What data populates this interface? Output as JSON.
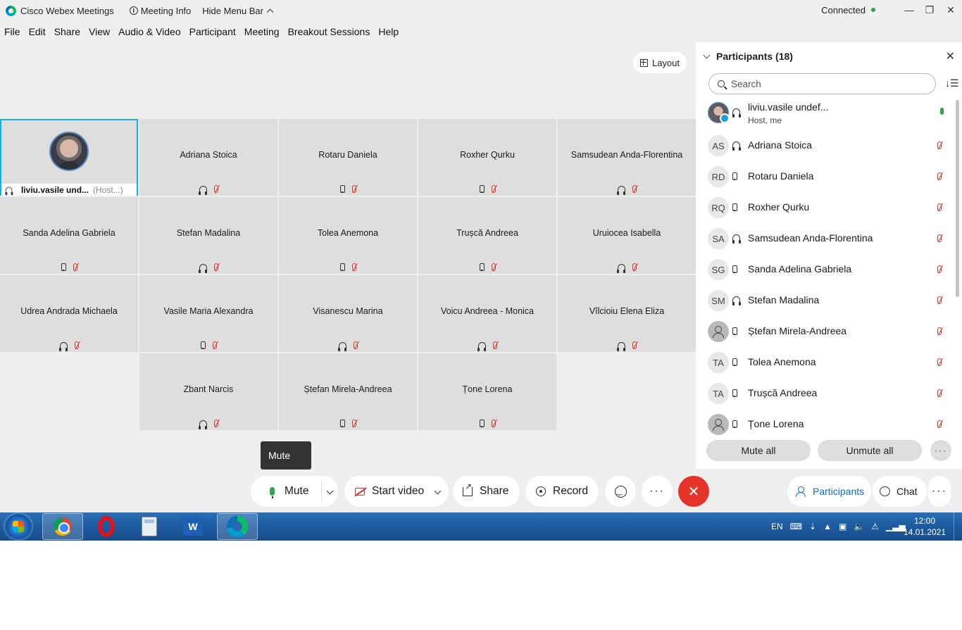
{
  "titlebar": {
    "app_name": "Cisco Webex Meetings",
    "meeting_info": "Meeting Info",
    "hide_menu_bar": "Hide Menu Bar",
    "status": "Connected"
  },
  "menu": [
    "File",
    "Edit",
    "Share",
    "View",
    "Audio & Video",
    "Participant",
    "Meeting",
    "Breakout Sessions",
    "Help"
  ],
  "layout_button": "Layout",
  "host_tile": {
    "name": "liviu.vasile und...",
    "role": "(Host...)"
  },
  "tiles": [
    {
      "name": "Adriana Stoica",
      "device": "headset"
    },
    {
      "name": "Rotaru Daniela",
      "device": "phone"
    },
    {
      "name": "Roxher Qurku",
      "device": "phone"
    },
    {
      "name": "Samsudean Anda-Florentina",
      "device": "headset"
    },
    {
      "name": "Sanda Adelina Gabriela",
      "device": "phone"
    },
    {
      "name": "Stefan Madalina",
      "device": "headset"
    },
    {
      "name": "Tolea Anemona",
      "device": "phone"
    },
    {
      "name": "Trușcă Andreea",
      "device": "phone"
    },
    {
      "name": "Uruiocea Isabella",
      "device": "headset"
    },
    {
      "name": "Udrea Andrada Michaela",
      "device": "headset"
    },
    {
      "name": "Vasile Maria Alexandra",
      "device": "phone"
    },
    {
      "name": "Visanescu Marina",
      "device": "headset"
    },
    {
      "name": "Voicu Andreea - Monica",
      "device": "headset"
    },
    {
      "name": "Vîlcioiu Elena Eliza",
      "device": "headset"
    },
    {
      "name": "Zbant Narcis",
      "device": "headset"
    },
    {
      "name": "Ștefan Mirela-Andreea",
      "device": "phone"
    },
    {
      "name": "Țone Lorena",
      "device": "phone"
    }
  ],
  "tooltip": "Mute",
  "controls": {
    "mute": "Mute",
    "start_video": "Start video",
    "share": "Share",
    "record": "Record",
    "participants": "Participants",
    "chat": "Chat"
  },
  "panel": {
    "title": "Participants (18)",
    "search_placeholder": "Search",
    "mute_all": "Mute all",
    "unmute_all": "Unmute all",
    "rows": [
      {
        "initials": "",
        "avatar": "photo",
        "name": "liviu.vasile undef...",
        "sub": "Host, me",
        "device": "headset",
        "mic": "on"
      },
      {
        "initials": "AS",
        "avatar": "initials",
        "name": "Adriana Stoica",
        "sub": "",
        "device": "headset",
        "mic": "muted"
      },
      {
        "initials": "RD",
        "avatar": "initials",
        "name": "Rotaru Daniela",
        "sub": "",
        "device": "phone",
        "mic": "muted"
      },
      {
        "initials": "RQ",
        "avatar": "initials",
        "name": "Roxher Qurku",
        "sub": "",
        "device": "phone",
        "mic": "muted"
      },
      {
        "initials": "SA",
        "avatar": "initials",
        "name": "Samsudean Anda-Florentina",
        "sub": "",
        "device": "headset",
        "mic": "muted"
      },
      {
        "initials": "SG",
        "avatar": "initials",
        "name": "Sanda Adelina Gabriela",
        "sub": "",
        "device": "phone",
        "mic": "muted"
      },
      {
        "initials": "SM",
        "avatar": "initials",
        "name": "Stefan Madalina",
        "sub": "",
        "device": "headset",
        "mic": "muted"
      },
      {
        "initials": "",
        "avatar": "blank",
        "name": "Ștefan Mirela-Andreea",
        "sub": "",
        "device": "phone",
        "mic": "muted"
      },
      {
        "initials": "TA",
        "avatar": "initials",
        "name": "Tolea Anemona",
        "sub": "",
        "device": "phone",
        "mic": "muted"
      },
      {
        "initials": "TA",
        "avatar": "initials",
        "name": "Trușcă Andreea",
        "sub": "",
        "device": "phone",
        "mic": "muted"
      },
      {
        "initials": "",
        "avatar": "blank",
        "name": "Țone Lorena",
        "sub": "",
        "device": "phone",
        "mic": "muted"
      }
    ]
  },
  "taskbar": {
    "language": "EN",
    "time": "12:00",
    "date": "14.01.2021"
  },
  "colors": {
    "accent": "#0a6bd0",
    "end_call": "#e5352b",
    "muted": "#d9342b",
    "connected": "#2ea64a",
    "active_tile_border": "#12b0e8"
  }
}
